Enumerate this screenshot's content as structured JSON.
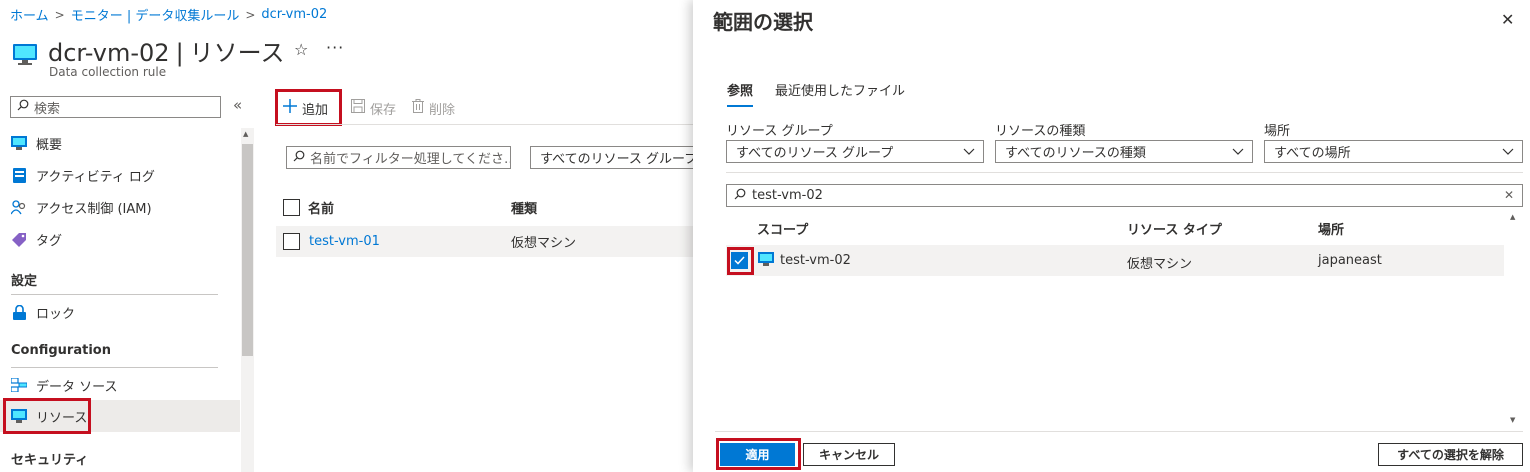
{
  "breadcrumb": {
    "items": [
      "ホーム",
      "モニター | データ収集ルール",
      "dcr-vm-02"
    ],
    "separator": ">"
  },
  "header": {
    "title_name": "dcr-vm-02",
    "title_divider": "|",
    "title_section": "リソース",
    "subtitle": "Data collection rule",
    "favorite_icon": "☆",
    "more_icon": "···"
  },
  "sidebar": {
    "search_placeholder": "検索",
    "collapse_icon": "«",
    "items": [
      {
        "label": "概要",
        "icon": "overview-icon"
      },
      {
        "label": "アクティビティ ログ",
        "icon": "activity-log-icon"
      },
      {
        "label": "アクセス制御 (IAM)",
        "icon": "iam-icon"
      },
      {
        "label": "タグ",
        "icon": "tag-icon"
      }
    ],
    "sections": [
      {
        "label": "設定",
        "items": [
          {
            "label": "ロック",
            "icon": "lock-icon"
          }
        ]
      },
      {
        "label": "Configuration",
        "items": [
          {
            "label": "データ ソース",
            "icon": "data-source-icon"
          },
          {
            "label": "リソース",
            "icon": "resource-icon",
            "selected": true
          }
        ]
      },
      {
        "label": "セキュリティ",
        "items": []
      }
    ]
  },
  "toolbar": {
    "add_label": "追加",
    "save_label": "保存",
    "delete_label": "削除"
  },
  "main": {
    "filter_placeholder": "名前でフィルター処理してくださ…",
    "resource_group_filter": "すべてのリソース グループ",
    "columns": [
      "名前",
      "種類"
    ],
    "rows": [
      {
        "name": "test-vm-01",
        "type": "仮想マシン"
      }
    ]
  },
  "blade": {
    "title": "範囲の選択",
    "close_icon": "✕",
    "tabs": [
      {
        "label": "参照",
        "active": true
      },
      {
        "label": "最近使用したファイル",
        "active": false
      }
    ],
    "filters": {
      "resource_group": {
        "label": "リソース グループ",
        "value": "すべてのリソース グループ"
      },
      "resource_type": {
        "label": "リソースの種類",
        "value": "すべてのリソースの種類"
      },
      "location": {
        "label": "場所",
        "value": "すべての場所"
      }
    },
    "search_value": "test-vm-02",
    "clear_icon": "✕",
    "table": {
      "columns": [
        "スコープ",
        "リソース タイプ",
        "場所"
      ],
      "rows": [
        {
          "scope": "test-vm-02",
          "type": "仮想マシン",
          "location": "japaneast",
          "checked": true
        }
      ]
    },
    "buttons": {
      "apply": "適用",
      "cancel": "キャンセル",
      "clear_all": "すべての選択を解除"
    }
  },
  "colors": {
    "accent": "#0078d4",
    "highlight_border": "#c50f1f",
    "selected_row": "#f3f2f1"
  }
}
